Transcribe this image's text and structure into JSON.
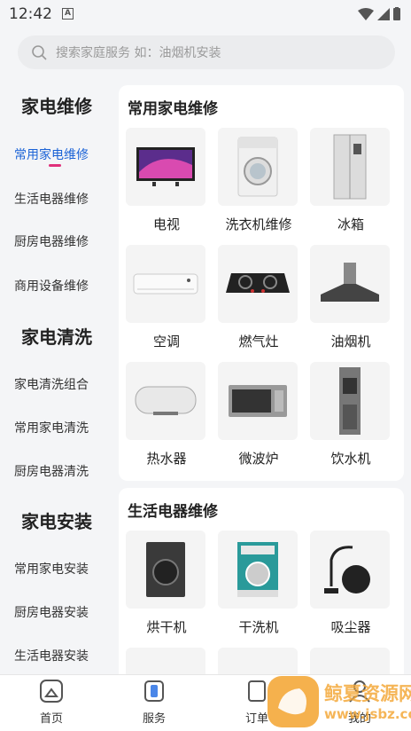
{
  "status": {
    "time": "12:42"
  },
  "search": {
    "placeholder": "搜索家庭服务 如：油烟机安装"
  },
  "sidebar": {
    "groups": [
      {
        "title": "家电维修",
        "items": [
          "常用家电维修",
          "生活电器维修",
          "厨房电器维修",
          "商用设备维修"
        ]
      },
      {
        "title": "家电清洗",
        "items": [
          "家电清洗组合",
          "常用家电清洗",
          "厨房电器清洗"
        ]
      },
      {
        "title": "家电安装",
        "items": [
          "常用家电安装",
          "厨房电器安装",
          "生活电器安装"
        ]
      }
    ],
    "active": "常用家电维修"
  },
  "sections": [
    {
      "title": "常用家电维修",
      "items": [
        "电视",
        "洗衣机维修",
        "冰箱",
        "空调",
        "燃气灶",
        "油烟机",
        "热水器",
        "微波炉",
        "饮水机"
      ]
    },
    {
      "title": "生活电器维修",
      "items": [
        "烘干机",
        "干洗机",
        "吸尘器"
      ]
    }
  ],
  "tabbar": {
    "items": [
      "首页",
      "服务",
      "订单",
      "我的"
    ]
  },
  "watermark": {
    "text": "鲸夏资源网",
    "url": "www.jsbz.com"
  },
  "colors": {
    "active": "#1a62d6",
    "indicator": "#e0307a"
  }
}
